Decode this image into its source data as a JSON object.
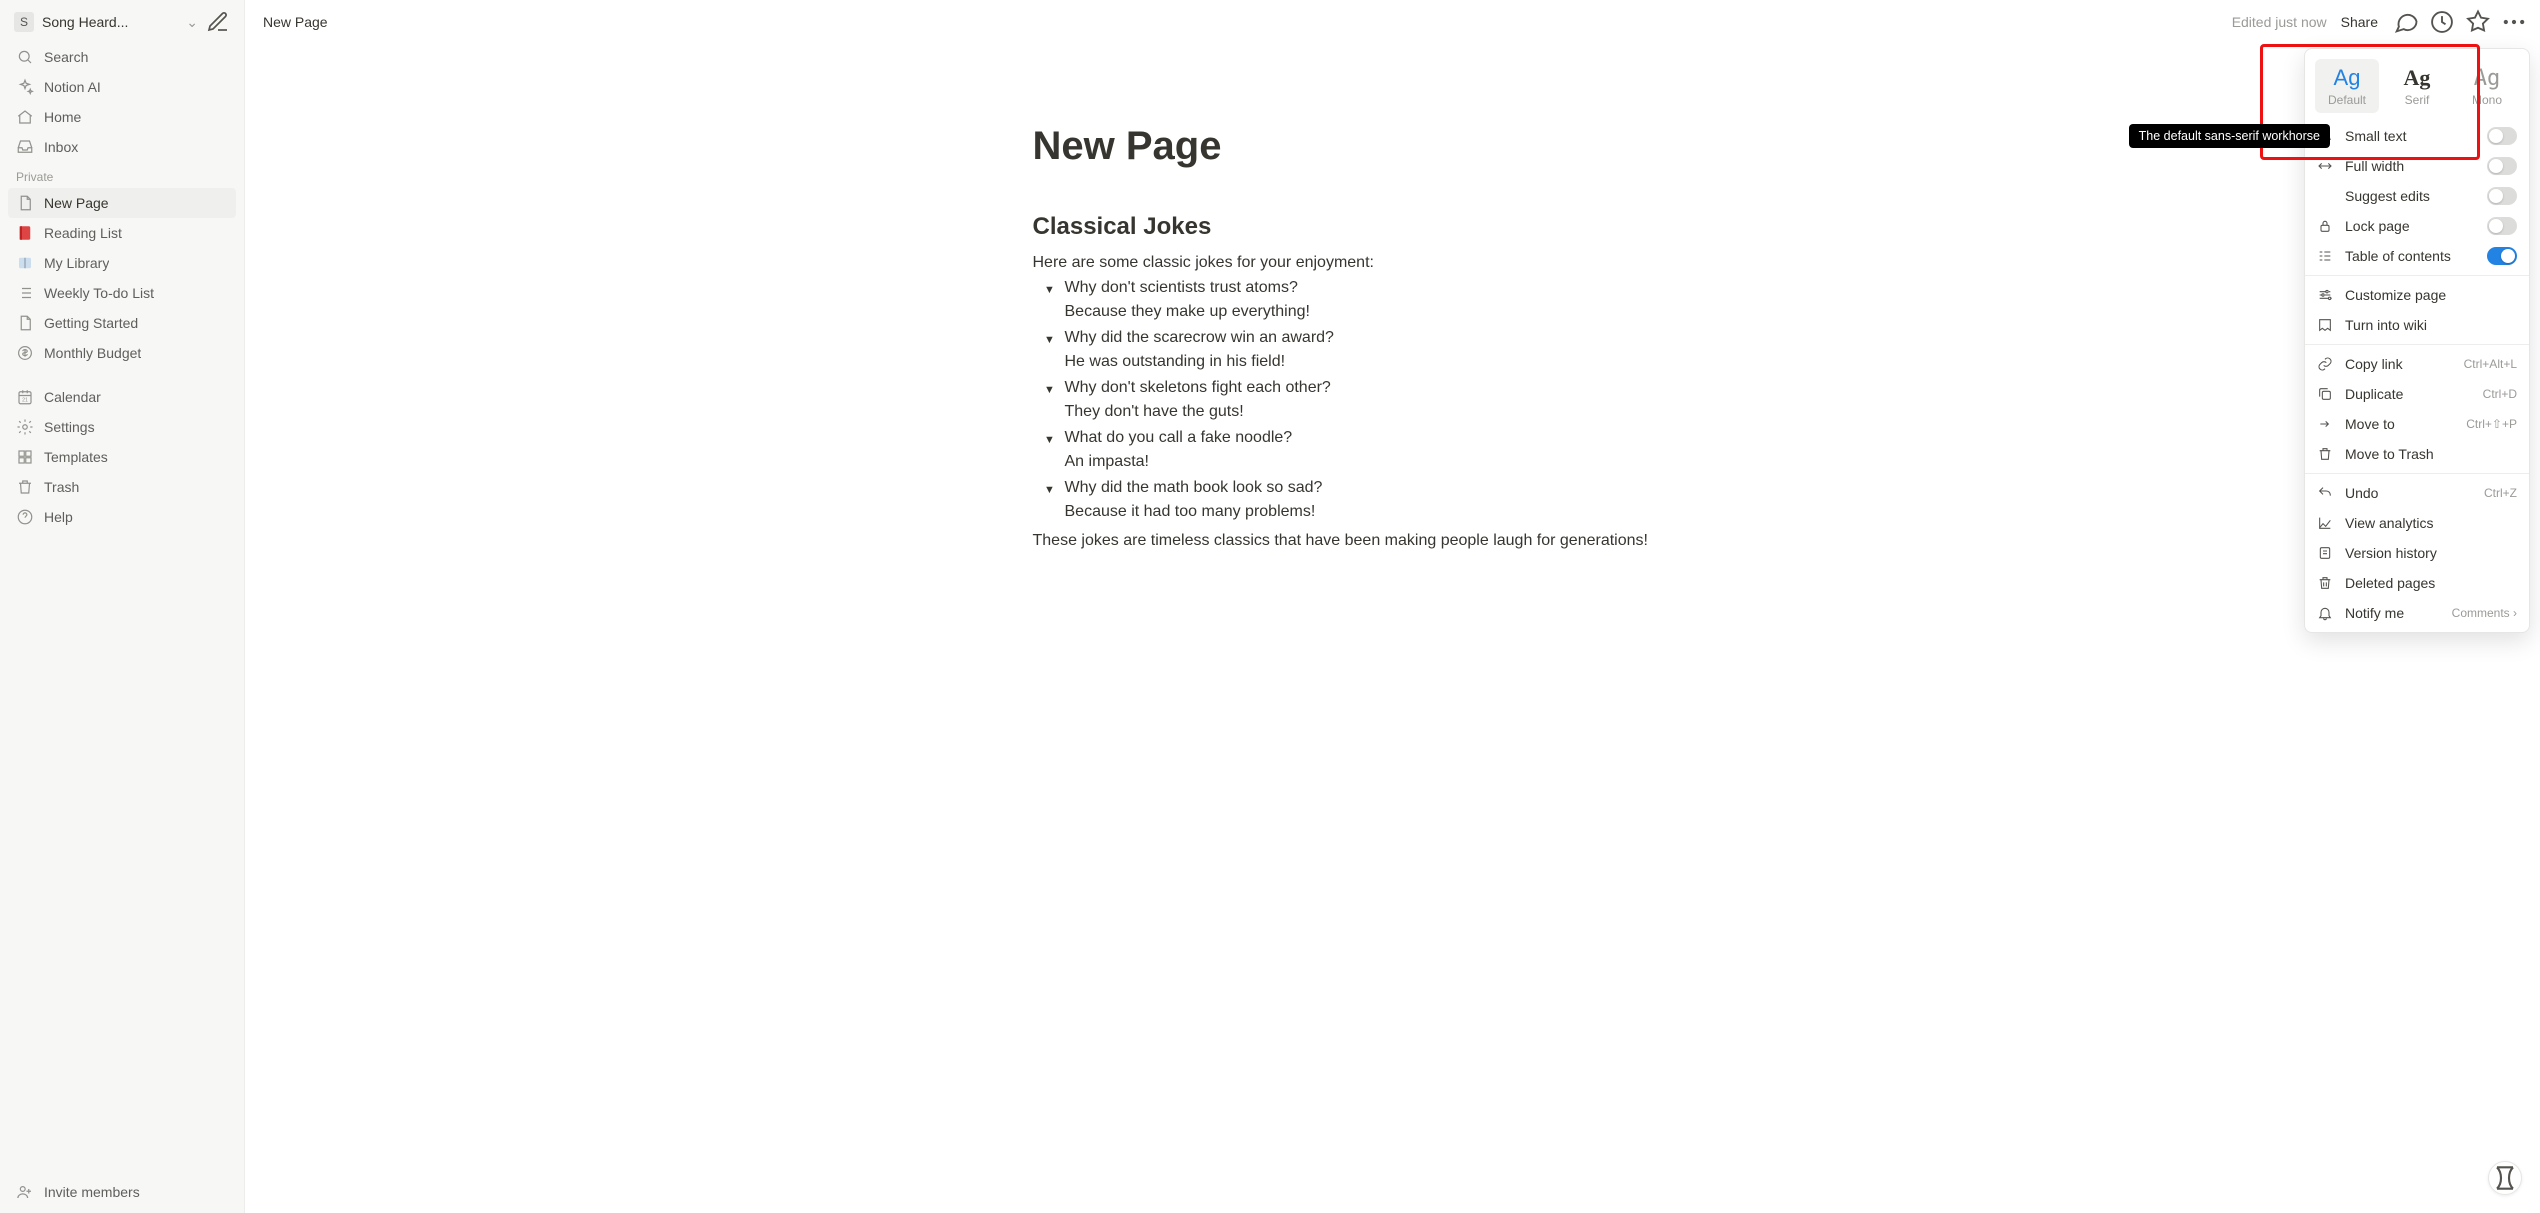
{
  "workspace": {
    "avatar_letter": "S",
    "name": "Song Heard..."
  },
  "sidebar": {
    "primary": [
      {
        "label": "Search",
        "icon": "search-icon"
      },
      {
        "label": "Notion AI",
        "icon": "sparkle-icon"
      },
      {
        "label": "Home",
        "icon": "home-icon"
      },
      {
        "label": "Inbox",
        "icon": "inbox-icon"
      }
    ],
    "section_label": "Private",
    "pages": [
      {
        "label": "New Page",
        "icon": "page-icon",
        "active": true
      },
      {
        "label": "Reading List",
        "icon": "book-red-icon"
      },
      {
        "label": "My Library",
        "icon": "book-blue-icon"
      },
      {
        "label": "Weekly To-do List",
        "icon": "list-icon"
      },
      {
        "label": "Getting Started",
        "icon": "page-icon"
      },
      {
        "label": "Monthly Budget",
        "icon": "money-icon"
      }
    ],
    "tools": [
      {
        "label": "Calendar",
        "icon": "calendar-icon"
      },
      {
        "label": "Settings",
        "icon": "gear-icon"
      },
      {
        "label": "Templates",
        "icon": "templates-icon"
      },
      {
        "label": "Trash",
        "icon": "trash-icon"
      },
      {
        "label": "Help",
        "icon": "help-icon"
      }
    ],
    "invite": "Invite members"
  },
  "topbar": {
    "breadcrumb": "New Page",
    "edited": "Edited just now",
    "share": "Share"
  },
  "page": {
    "title": "New Page",
    "heading": "Classical Jokes",
    "intro": "Here are some classic jokes for your enjoyment:",
    "jokes": [
      {
        "q": "Why don't scientists trust atoms?",
        "a": "Because they make up everything!"
      },
      {
        "q": "Why did the scarecrow win an award?",
        "a": "He was outstanding in his field!"
      },
      {
        "q": "Why don't skeletons fight each other?",
        "a": "They don't have the guts!"
      },
      {
        "q": "What do you call a fake noodle?",
        "a": "An impasta!"
      },
      {
        "q": "Why did the math book look so sad?",
        "a": "Because it had too many problems!"
      }
    ],
    "outro": "These jokes are timeless classics that have been making people laugh for generations!"
  },
  "menu": {
    "fonts": {
      "default": "Default",
      "serif": "Serif",
      "mono": "Mono",
      "sample": "Ag"
    },
    "tooltip": "The default sans-serif workhorse",
    "toggles": [
      {
        "label": "Small text",
        "icon": "smalltext-icon",
        "on": false
      },
      {
        "label": "Full width",
        "icon": "fullwidth-icon",
        "on": false
      },
      {
        "label": "Suggest edits",
        "icon": "",
        "on": false
      },
      {
        "label": "Lock page",
        "icon": "lock-icon",
        "on": false
      },
      {
        "label": "Table of contents",
        "icon": "toc-icon",
        "on": true
      }
    ],
    "group2": [
      {
        "label": "Customize page",
        "icon": "customize-icon"
      },
      {
        "label": "Turn into wiki",
        "icon": "wiki-icon"
      }
    ],
    "group3": [
      {
        "label": "Copy link",
        "icon": "link-icon",
        "hk": "Ctrl+Alt+L"
      },
      {
        "label": "Duplicate",
        "icon": "duplicate-icon",
        "hk": "Ctrl+D"
      },
      {
        "label": "Move to",
        "icon": "moveto-icon",
        "hk": "Ctrl+⇧+P"
      },
      {
        "label": "Move to Trash",
        "icon": "trash-icon",
        "hk": ""
      }
    ],
    "group4": [
      {
        "label": "Undo",
        "icon": "undo-icon",
        "hk": "Ctrl+Z"
      },
      {
        "label": "View analytics",
        "icon": "analytics-icon",
        "hk": ""
      },
      {
        "label": "Version history",
        "icon": "history-icon",
        "hk": ""
      },
      {
        "label": "Deleted pages",
        "icon": "deleted-icon",
        "hk": ""
      },
      {
        "label": "Notify me",
        "icon": "bell-icon",
        "hk": "Comments  ›"
      }
    ]
  }
}
